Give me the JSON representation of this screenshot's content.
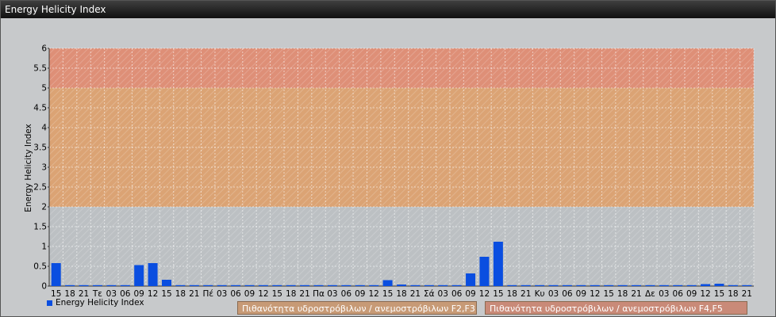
{
  "window": {
    "title": "Energy Helicity Index"
  },
  "colors": {
    "bar": "#0a4ee0",
    "band_low": "#bcc0c3",
    "band_mid": "#dba374",
    "band_high": "#de8f77",
    "chart_bg": "#c7c9cb"
  },
  "legend": {
    "series_label": "Energy Helicity Index",
    "band1": "Πιθανότητα υδροστρόβιλων / ανεμοστρόβιλων F2,F3",
    "band2": "Πιθανότητα υδροστρόβιλων / ανεμοστρόβιλων F4,F5"
  },
  "chart_data": {
    "type": "bar",
    "ylabel": "Energy Helicity Index",
    "xlabel": "",
    "ylim": [
      0,
      6
    ],
    "yticks": [
      "0",
      "0.5",
      "1",
      "1.5",
      "2",
      "2.5",
      "3",
      "3.5",
      "4",
      "4.5",
      "5",
      "5.5",
      "6"
    ],
    "bands": [
      {
        "from": 0,
        "to": 2
      },
      {
        "from": 2,
        "to": 5
      },
      {
        "from": 5,
        "to": 6
      }
    ],
    "categories": [
      "15",
      "18",
      "21",
      "Τε",
      "03",
      "06",
      "09",
      "12",
      "15",
      "18",
      "21",
      "Πέ",
      "03",
      "06",
      "09",
      "12",
      "15",
      "18",
      "21",
      "Πα",
      "03",
      "06",
      "09",
      "12",
      "15",
      "18",
      "21",
      "Σά",
      "03",
      "06",
      "09",
      "12",
      "15",
      "18",
      "21",
      "Κυ",
      "03",
      "06",
      "09",
      "12",
      "15",
      "18",
      "21",
      "Δε",
      "03",
      "06",
      "09",
      "12",
      "15",
      "18",
      "21"
    ],
    "series": [
      {
        "values": [
          0.58,
          0.01,
          0.01,
          0.01,
          0.01,
          0.01,
          0.53,
          0.58,
          0.16,
          0.01,
          0.01,
          0.01,
          0.01,
          0.01,
          0.01,
          0.01,
          0.01,
          0.01,
          0.01,
          0.01,
          0.01,
          0.01,
          0.01,
          0.01,
          0.15,
          0.04,
          0.01,
          0.01,
          0.01,
          0.01,
          0.32,
          0.74,
          1.12,
          0.01,
          0.01,
          0.01,
          0.01,
          0.01,
          0.01,
          0.01,
          0.01,
          0.01,
          0.01,
          0.01,
          0.01,
          0.01,
          0.01,
          0.05,
          0.06,
          0.01,
          0.01
        ]
      }
    ]
  }
}
